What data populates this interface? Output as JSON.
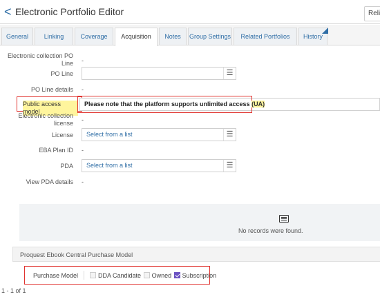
{
  "header": {
    "back_glyph": "<",
    "title": "Electronic Portfolio Editor",
    "right_button": "Reli"
  },
  "tabs": [
    {
      "label": "General",
      "active": false
    },
    {
      "label": "Linking",
      "active": false
    },
    {
      "label": "Coverage",
      "active": false
    },
    {
      "label": "Acquisition",
      "active": true
    },
    {
      "label": "Notes",
      "active": false
    },
    {
      "label": "Group Settings",
      "active": false
    },
    {
      "label": "Related Portfolios",
      "active": false
    },
    {
      "label": "History",
      "active": false
    }
  ],
  "form": {
    "electronic_collection_po_line_label": "Electronic collection PO Line",
    "electronic_collection_po_line_value": "-",
    "po_line_label": "PO Line",
    "po_line_value": "",
    "po_line_details_label": "PO Line details",
    "po_line_details_value": "-",
    "public_access_model_label": "Public access model",
    "public_access_model_text": "Please note that the platform supports unlimited access",
    "public_access_model_code": "(UA)",
    "electronic_collection_license_label": "Electronic collection license",
    "electronic_collection_license_value": "-",
    "license_label": "License",
    "license_value": "Select from a list",
    "eba_plan_id_label": "EBA Plan ID",
    "eba_plan_id_value": "-",
    "pda_label": "PDA",
    "pda_value": "Select from a list",
    "view_pda_details_label": "View PDA details",
    "view_pda_details_value": "-"
  },
  "records_panel": {
    "icon": "list-icon",
    "message": "No records were found."
  },
  "purchase_section": {
    "title": "Proquest Ebook Central Purchase Model",
    "purchase_model_label": "Purchase Model",
    "options": [
      {
        "label": "DDA Candidate",
        "checked": false
      },
      {
        "label": "Owned",
        "checked": false
      },
      {
        "label": "Subscription",
        "checked": true
      }
    ]
  },
  "pagination": {
    "text": "1 - 1 of 1"
  },
  "colors": {
    "highlight_box": "#e0332f",
    "highlight_text": "#fff59d",
    "link": "#2f6ea6",
    "checkbox_checked": "#6b52c2"
  }
}
